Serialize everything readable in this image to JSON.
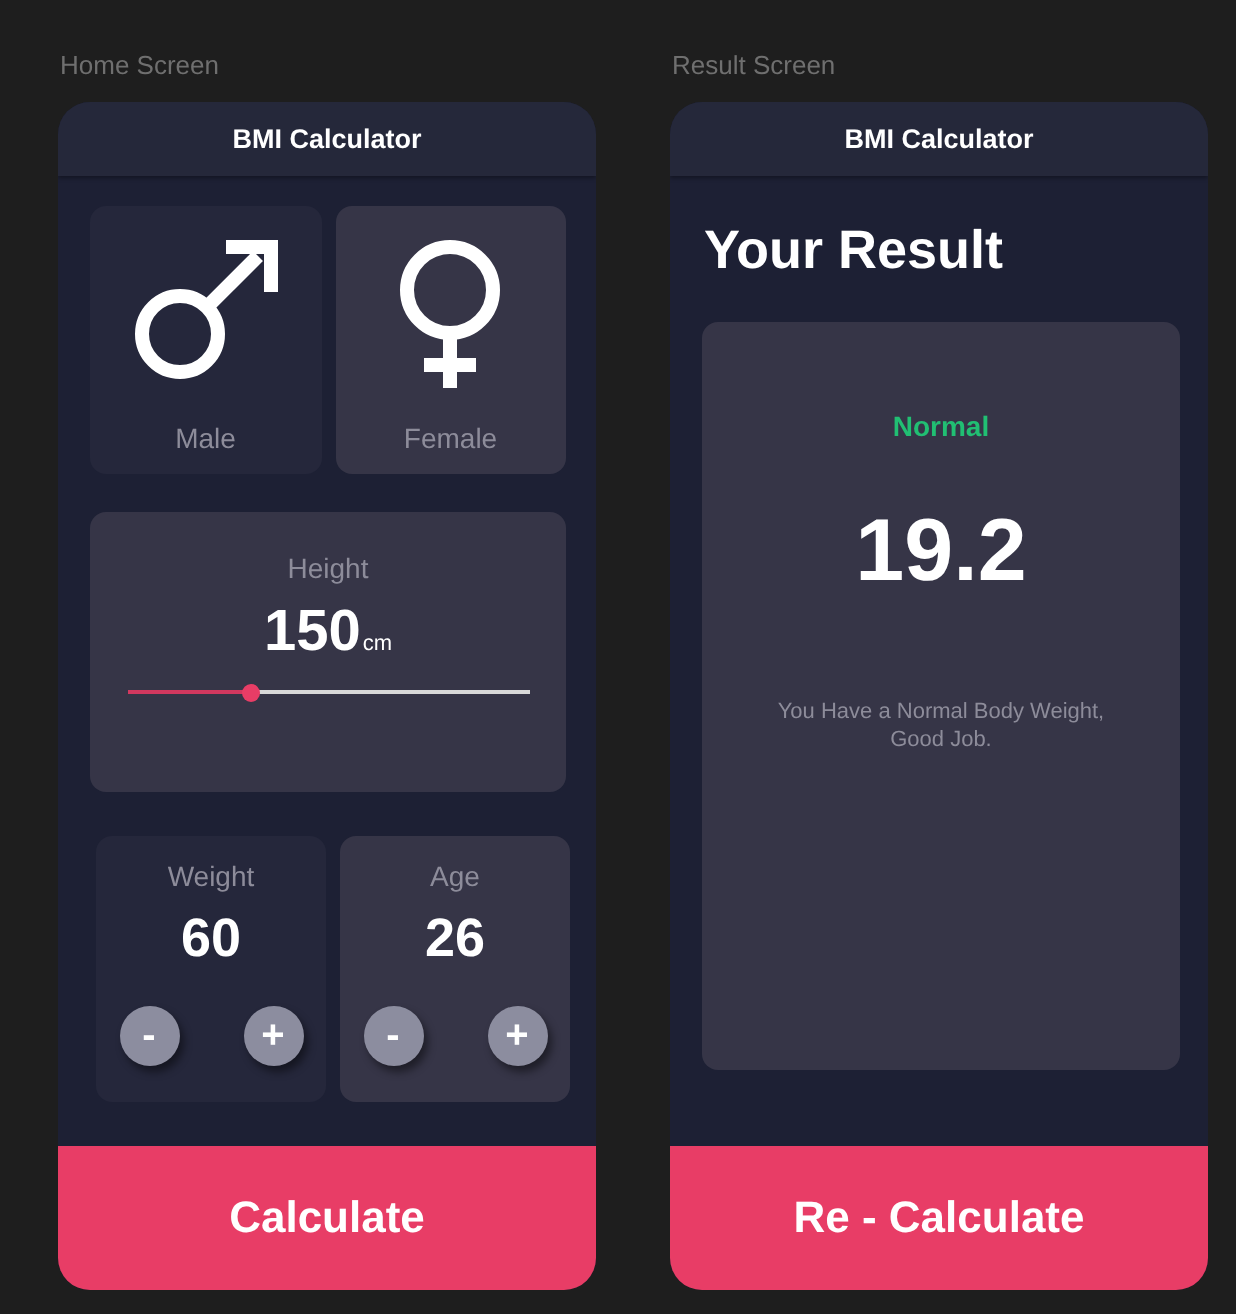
{
  "screens": [
    {
      "kind": "home",
      "label": "Home Screen",
      "app_bar": {
        "title": "BMI Calculator"
      },
      "genders": [
        {
          "kind": "male",
          "label": "Male",
          "selected": false
        },
        {
          "kind": "female",
          "label": "Female",
          "selected": true
        }
      ],
      "height": {
        "label": "Height",
        "value": "150",
        "unit": "cm",
        "level": 0.31
      },
      "counters": [
        {
          "label": "Weight",
          "value": "60",
          "selected": false,
          "buttons": [
            "-",
            "+"
          ]
        },
        {
          "label": "Age",
          "value": "26",
          "selected": true,
          "buttons": [
            "-",
            "+"
          ]
        }
      ],
      "action": {
        "label": "Calculate"
      }
    },
    {
      "kind": "result",
      "label": "Result Screen",
      "app_bar": {
        "title": "BMI Calculator"
      },
      "heading": "Your Result",
      "result": {
        "status": "Normal",
        "value": "19.2",
        "message": "You Have a Normal Body Weight, Good Job."
      },
      "action": {
        "label": "Re - Calculate"
      }
    }
  ]
}
